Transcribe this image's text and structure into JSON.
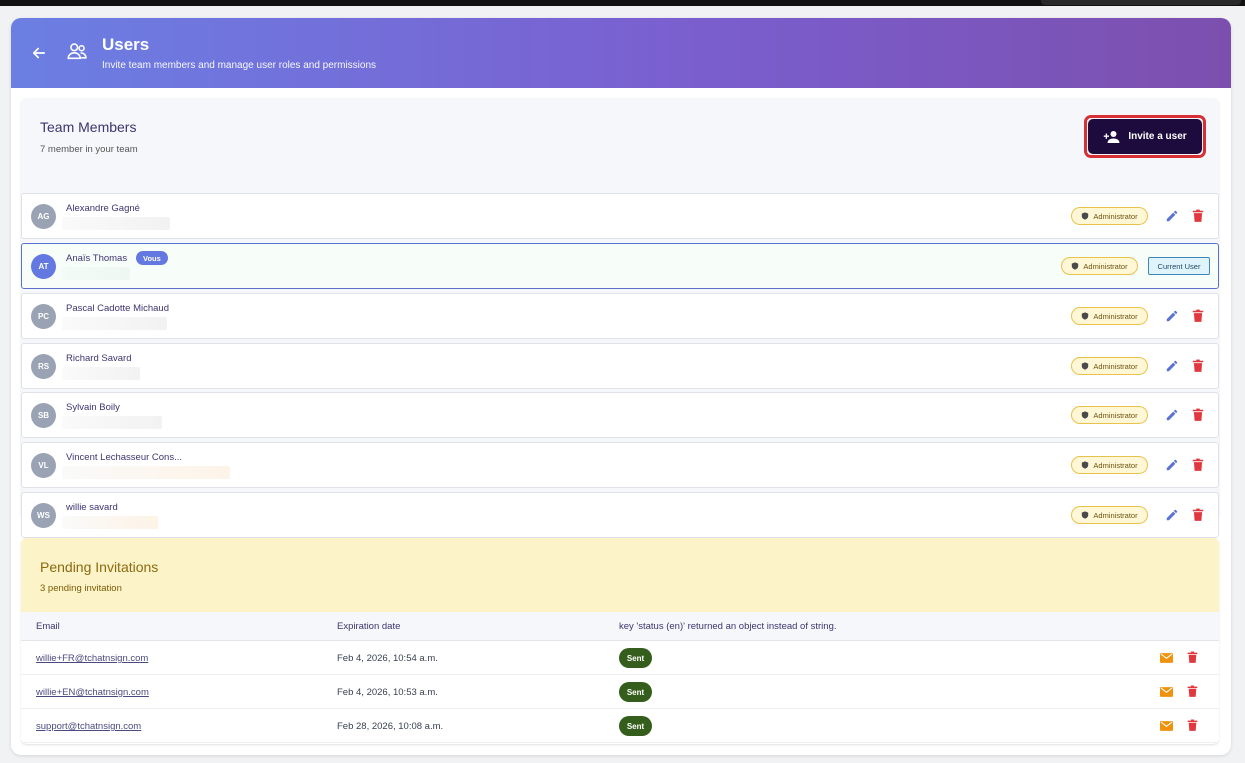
{
  "header": {
    "title": "Users",
    "subtitle": "Invite team members and manage user roles and permissions"
  },
  "team": {
    "title": "Team Members",
    "subtitle": "7 member in your team",
    "invite_label": "Invite a user",
    "members": [
      {
        "initials": "AG",
        "name": "Alexandre Gagné",
        "role": "Administrator"
      },
      {
        "initials": "AT",
        "name": "Anaïs Thomas",
        "role": "Administrator",
        "you_badge": "Vous",
        "current_tag": "Current User"
      },
      {
        "initials": "PC",
        "name": "Pascal Cadotte Michaud",
        "role": "Administrator"
      },
      {
        "initials": "RS",
        "name": "Richard Savard",
        "role": "Administrator"
      },
      {
        "initials": "SB",
        "name": "Sylvain Boily",
        "role": "Administrator"
      },
      {
        "initials": "VL",
        "name": "Vincent Lechasseur Cons...",
        "role": "Administrator"
      },
      {
        "initials": "WS",
        "name": "willie savard",
        "role": "Administrator"
      }
    ]
  },
  "pending": {
    "title": "Pending Invitations",
    "subtitle": "3 pending invitation",
    "columns": [
      "Email",
      "Expiration date",
      "key 'status (en)' returned an object instead of string."
    ],
    "rows": [
      {
        "email": "willie+FR@tchatnsign.com",
        "expires": "Feb 4, 2026, 10:54 a.m.",
        "status": "Sent"
      },
      {
        "email": "willie+EN@tchatnsign.com",
        "expires": "Feb 4, 2026, 10:53 a.m.",
        "status": "Sent"
      },
      {
        "email": "support@tchatnsign.com",
        "expires": "Feb 28, 2026, 10:08 a.m.",
        "status": "Sent"
      }
    ]
  },
  "colors": {
    "header_start": "#6b7fe3",
    "header_end": "#7c4fae",
    "invite_button": "#1d0b3e",
    "highlight_outline": "#d63035",
    "admin_badge_bg": "#fff7d6",
    "sent_pill": "#355e1c",
    "delete_icon": "#e0383e",
    "edit_icon": "#5a72d6",
    "mail_icon": "#f0920c"
  },
  "icons": {
    "back": "arrow-left-icon",
    "users": "users-icon",
    "invite": "person-add-icon",
    "role": "shield-icon",
    "edit": "pencil-icon",
    "delete": "trash-icon",
    "resend": "mail-icon"
  }
}
